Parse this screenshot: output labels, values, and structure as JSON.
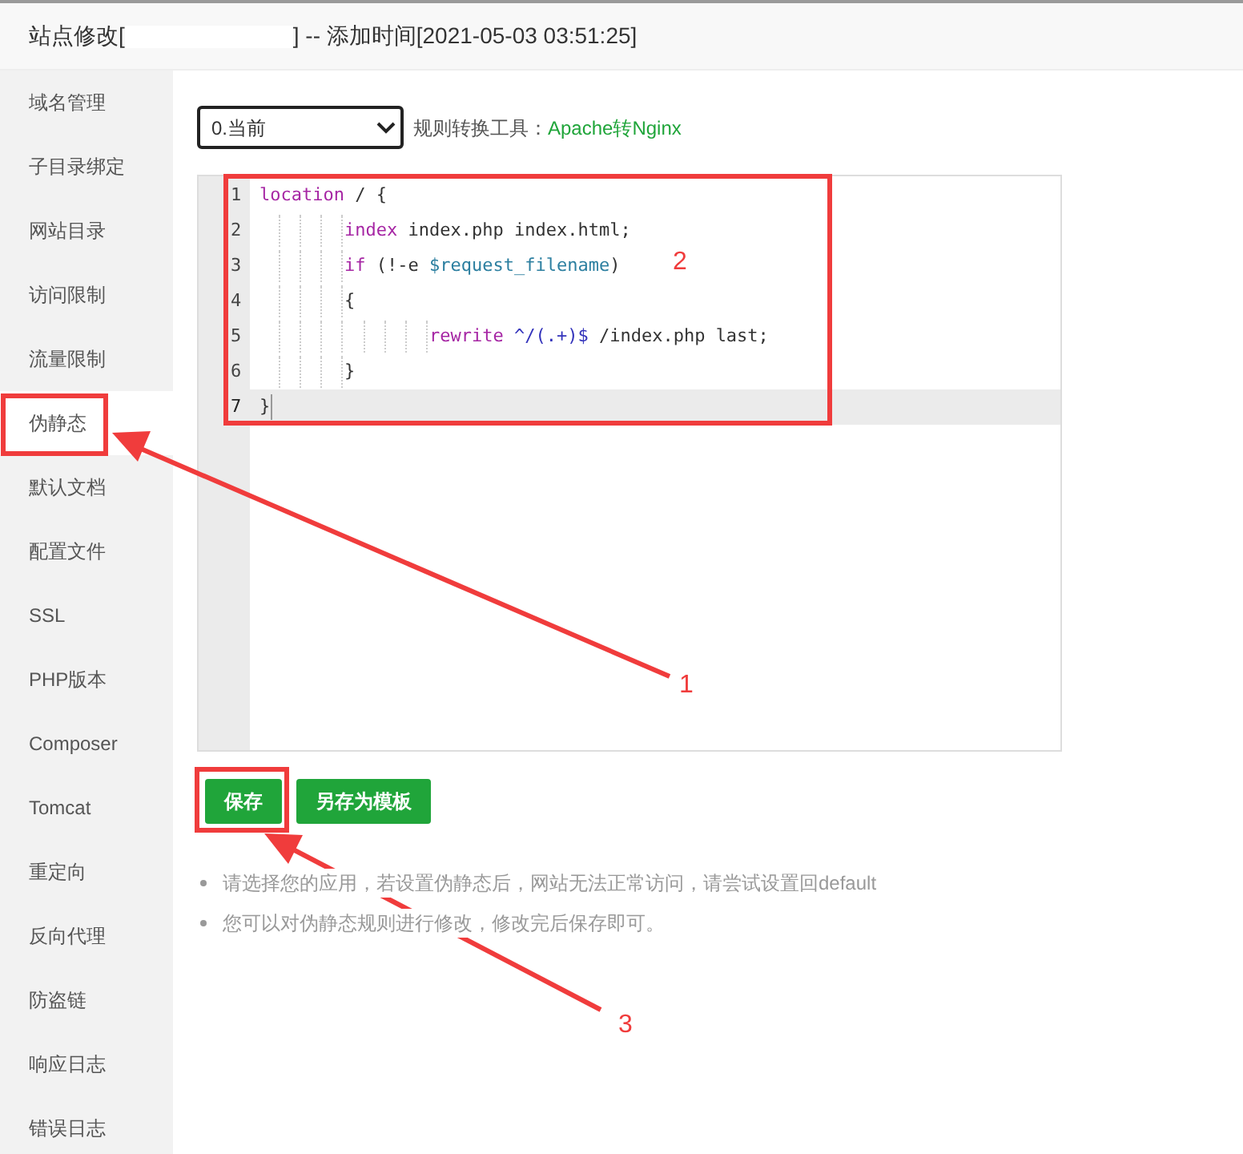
{
  "window": {
    "title_prefix": "站点修改[",
    "title_suffix": "] -- 添加时间[2021-05-03 03:51:25]"
  },
  "sidebar": {
    "items": [
      {
        "label": "域名管理",
        "selected": false
      },
      {
        "label": "子目录绑定",
        "selected": false
      },
      {
        "label": "网站目录",
        "selected": false
      },
      {
        "label": "访问限制",
        "selected": false
      },
      {
        "label": "流量限制",
        "selected": false
      },
      {
        "label": "伪静态",
        "selected": true
      },
      {
        "label": "默认文档",
        "selected": false
      },
      {
        "label": "配置文件",
        "selected": false
      },
      {
        "label": "SSL",
        "selected": false
      },
      {
        "label": "PHP版本",
        "selected": false
      },
      {
        "label": "Composer",
        "selected": false
      },
      {
        "label": "Tomcat",
        "selected": false
      },
      {
        "label": "重定向",
        "selected": false
      },
      {
        "label": "反向代理",
        "selected": false
      },
      {
        "label": "防盗链",
        "selected": false
      },
      {
        "label": "响应日志",
        "selected": false
      },
      {
        "label": "错误日志",
        "selected": false
      }
    ]
  },
  "toolbar": {
    "select_value": "0.当前",
    "label": "规则转换工具：",
    "link": "Apache转Nginx"
  },
  "editor": {
    "lines": [
      {
        "number": "1",
        "selected": false,
        "tokens": [
          {
            "kind": "keyword",
            "text": "location"
          },
          {
            "kind": "plain",
            "text": " / {"
          }
        ]
      },
      {
        "number": "2",
        "selected": false,
        "tokens": [
          {
            "kind": "indent"
          },
          {
            "kind": "keyword",
            "text": "index"
          },
          {
            "kind": "plain",
            "text": " index.php index.html;"
          }
        ]
      },
      {
        "number": "3",
        "selected": false,
        "tokens": [
          {
            "kind": "indent"
          },
          {
            "kind": "keyword",
            "text": "if"
          },
          {
            "kind": "plain",
            "text": " (!-e "
          },
          {
            "kind": "variable",
            "text": "$request_filename"
          },
          {
            "kind": "plain",
            "text": ")"
          }
        ]
      },
      {
        "number": "4",
        "selected": false,
        "tokens": [
          {
            "kind": "indent"
          },
          {
            "kind": "plain",
            "text": "{"
          }
        ]
      },
      {
        "number": "5",
        "selected": false,
        "tokens": [
          {
            "kind": "indent"
          },
          {
            "kind": "indent"
          },
          {
            "kind": "keyword",
            "text": "rewrite "
          },
          {
            "kind": "regex",
            "text": "^/(.+)$"
          },
          {
            "kind": "plain",
            "text": " /index.php last;"
          }
        ]
      },
      {
        "number": "6",
        "selected": false,
        "tokens": [
          {
            "kind": "indent"
          },
          {
            "kind": "plain",
            "text": "}"
          }
        ]
      },
      {
        "number": "7",
        "selected": true,
        "tokens": [
          {
            "kind": "plain",
            "text": "}"
          }
        ]
      }
    ]
  },
  "buttons": [
    "保存",
    "另存为模板"
  ],
  "notes": [
    "请选择您的应用，若设置伪静态后，网站无法正常访问，请尝试设置回default",
    "您可以对伪静态规则进行修改，修改完后保存即可。"
  ],
  "annotations": [
    {
      "label": "1"
    },
    {
      "label": "2"
    },
    {
      "label": "3"
    }
  ]
}
